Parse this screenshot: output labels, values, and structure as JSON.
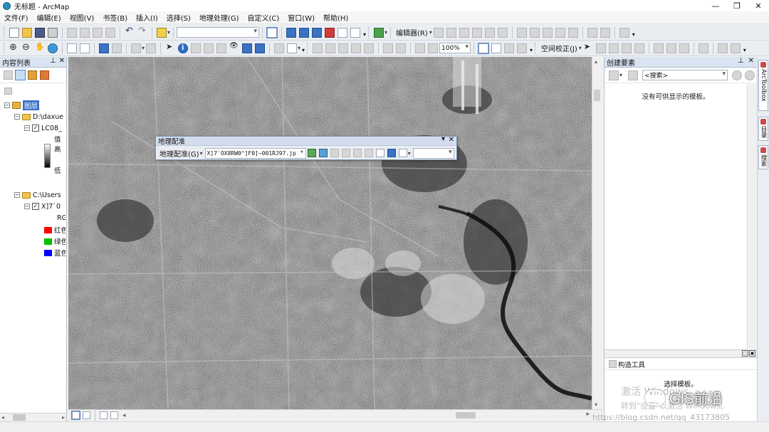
{
  "window": {
    "title": "无标题 - ArcMap",
    "minimize": "—",
    "restore": "❐",
    "close": "✕"
  },
  "menu": [
    "文件(F)",
    "编辑(E)",
    "视图(V)",
    "书签(B)",
    "插入(I)",
    "选择(S)",
    "地理处理(G)",
    "自定义(C)",
    "窗口(W)",
    "帮助(H)"
  ],
  "toolbar1": {
    "scale_value": "",
    "editor_label": "编辑器(R)"
  },
  "toolbar2": {
    "zoom_value": "100%",
    "spatial_adjust_label": "空间校正(J)"
  },
  "toc": {
    "title": "内容列表",
    "layers_label": "图层",
    "group1_path": "D:\\daxue",
    "layer1_name": "LC08_",
    "legend_title": "值",
    "legend_high": "高",
    "legend_low": "低",
    "group2_path": "C:\\Users",
    "layer2_name": "X]7`0",
    "layer2_sub": "RG",
    "band_red": "红色",
    "band_green": "绿色",
    "band_blue": "蓝色",
    "colors": {
      "red": "#ff0000",
      "green": "#00c000",
      "blue": "#0000ff"
    }
  },
  "georef": {
    "title": "地理配准",
    "menu_label": "地理配准(G)",
    "layer_value": "X]7`OX8RW0^]F0]~001RJ97.jp",
    "input_value": ""
  },
  "create_features": {
    "title": "创建要素",
    "search_placeholder": "<搜索>",
    "empty_msg": "没有可供显示的模板。",
    "construct_title": "构造工具",
    "construct_hint": "选择模板。"
  },
  "dock": {
    "tab1": "ArcToolbox",
    "tab2": "目录",
    "tab3": "搜索"
  },
  "overlay": {
    "activate_text": "激活 Windows",
    "activate_sub": "转到\"设置\"以激活 Windows。",
    "brand": "GIS前沿",
    "url": "https://blog.csdn.net/qq_43173805"
  }
}
